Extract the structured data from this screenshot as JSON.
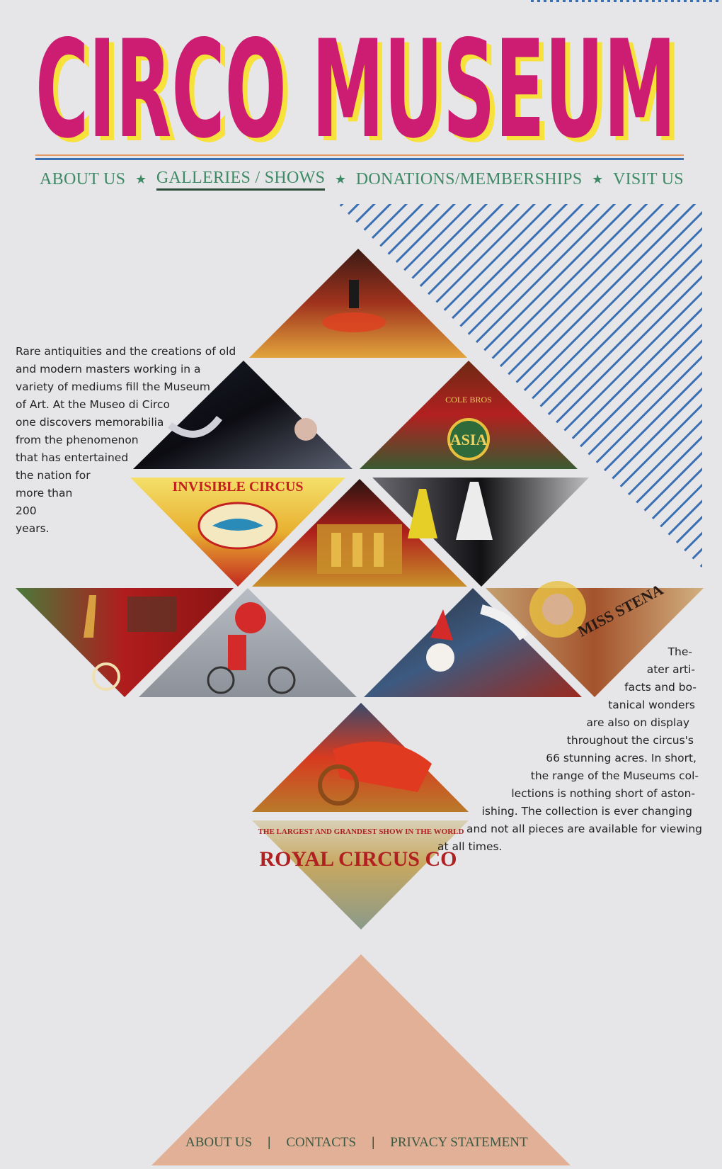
{
  "site": {
    "title": "CIRCO MUSEUM"
  },
  "nav": {
    "items": [
      {
        "label": "ABOUT US",
        "active": false
      },
      {
        "label": "GALLERIES / SHOWS",
        "active": true
      },
      {
        "label": "DONATIONS/MEMBERSHIPS",
        "active": false
      },
      {
        "label": "VISIT US",
        "active": false
      }
    ],
    "separator_icon": "star-icon"
  },
  "intro": {
    "lines": [
      "Rare antiquities and the creations of old",
      "and modern masters working in a",
      "variety of mediums fill the Museum",
      "of Art. At the Museo di Circo",
      "one discovers memorabilia",
      "from the phenomenon",
      "that has entertained",
      "the nation for",
      "more than",
      "200",
      "years."
    ]
  },
  "details": {
    "lines": [
      "The-",
      "ater arti-",
      "facts and bo-",
      "tanical wonders",
      "are also on display",
      "throughout the circus's",
      "66 stunning acres. In short,",
      "the range of the Museums col-",
      "lections is nothing short of aston-",
      "ishing. The collection is ever changing",
      "and not all pieces are available for viewing",
      "at all times."
    ]
  },
  "gallery": {
    "images": [
      {
        "name": "museum-hall-photo"
      },
      {
        "name": "aerial-performers-photo"
      },
      {
        "name": "asia-wagon-photo"
      },
      {
        "name": "invisible-circus-poster"
      },
      {
        "name": "gold-carved-wagon-photo"
      },
      {
        "name": "costume-gowns-photo"
      },
      {
        "name": "giraffe-wagon-photo"
      },
      {
        "name": "clown-bicycle-photo"
      },
      {
        "name": "clown-costume-photo"
      },
      {
        "name": "miss-stena-poster"
      },
      {
        "name": "red-chariot-photo"
      },
      {
        "name": "royal-circus-poster"
      }
    ],
    "poster_text": {
      "invisible_circus": "INVISIBLE CIRCUS",
      "asia": "ASIA",
      "cole_bros": "COLE BROS",
      "miss_stena": "MISS STENA",
      "largest_show": "THE LARGEST AND GRANDEST SHOW IN THE WORLD",
      "royal_circus": "ROYAL CIRCUS CO"
    }
  },
  "footer": {
    "links": [
      "ABOUT US",
      "CONTACTS",
      "PRIVACY STATEMENT"
    ],
    "separator": "|"
  },
  "colors": {
    "background": "#e6e6e8",
    "title_magenta": "#cc1d72",
    "title_yellow": "#f7e23c",
    "nav_green": "#3f8a66",
    "stripe_blue": "#3a6fb3",
    "footer_triangle": "#e2b096"
  }
}
